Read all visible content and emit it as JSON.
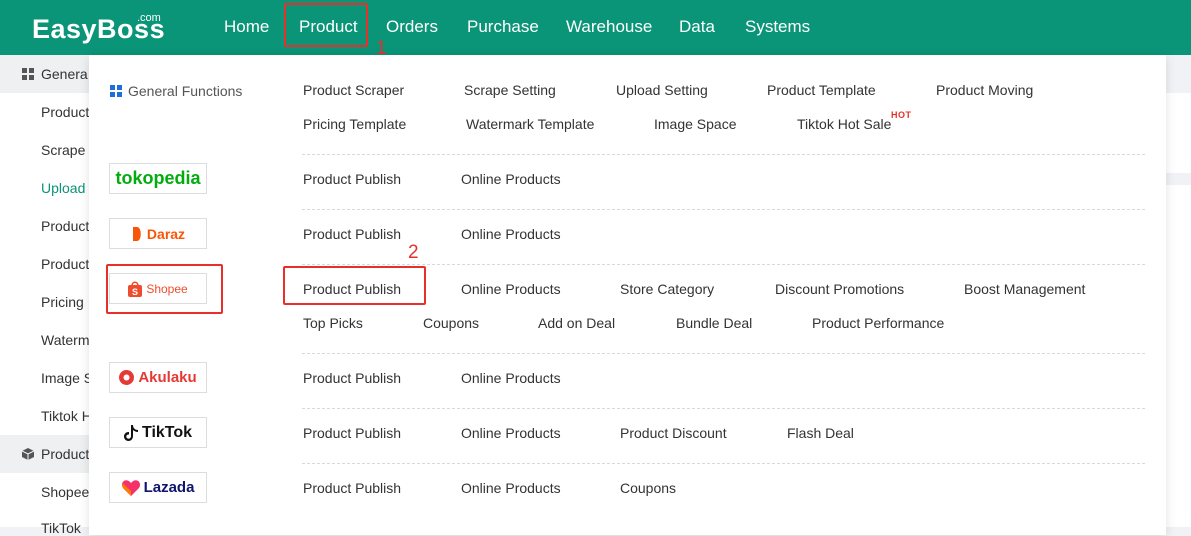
{
  "header": {
    "logo": "EasyBoss",
    "logo_suffix": ".com",
    "nav": [
      "Home",
      "Product",
      "Orders",
      "Purchase",
      "Warehouse",
      "Data",
      "Systems"
    ],
    "active_nav": "Product"
  },
  "annotations": {
    "step1": "1",
    "step2": "2",
    "color": "#e8302b"
  },
  "sidebar": {
    "group1_label": "Genera",
    "items1": [
      "Product",
      "Scrape",
      "Upload",
      "Product",
      "Product",
      "Pricing",
      "Waterm",
      "Image S",
      "Tiktok H"
    ],
    "active_item": "Upload",
    "group2_label": "Product",
    "items2": [
      "Shopee",
      "TikTok"
    ]
  },
  "dropdown": {
    "general_label": "General Functions",
    "general_row1": [
      "Product Scraper",
      "Scrape Setting",
      "Upload Setting",
      "Product Template",
      "Product Moving"
    ],
    "general_row2": [
      "Pricing Template",
      "Watermark Template",
      "Image Space",
      "Tiktok Hot Sale"
    ],
    "hot_badge": "HOT",
    "platforms": {
      "tokopedia": {
        "name": "tokopedia",
        "links": [
          "Product Publish",
          "Online Products"
        ]
      },
      "daraz": {
        "name": "Daraz",
        "links": [
          "Product Publish",
          "Online Products"
        ]
      },
      "shopee": {
        "name": "Shopee",
        "links_row1": [
          "Product Publish",
          "Online Products",
          "Store Category",
          "Discount Promotions",
          "Boost Management"
        ],
        "links_row2": [
          "Top Picks",
          "Coupons",
          "Add on Deal",
          "Bundle Deal",
          "Product Performance"
        ]
      },
      "akulaku": {
        "name": "Akulaku",
        "links": [
          "Product Publish",
          "Online Products"
        ]
      },
      "tiktok": {
        "name": "TikTok",
        "links": [
          "Product Publish",
          "Online Products",
          "Product Discount",
          "Flash Deal"
        ]
      },
      "lazada": {
        "name": "Lazada",
        "links": [
          "Product Publish",
          "Online Products",
          "Coupons"
        ]
      }
    }
  },
  "colors": {
    "brand": "#0a9478",
    "highlight": "#e8302b",
    "tokopedia": "#03ac0e",
    "daraz": "#f85606",
    "shopee": "#ee4d2d",
    "akulaku": "#e53935",
    "lazada": "#0f146d"
  }
}
